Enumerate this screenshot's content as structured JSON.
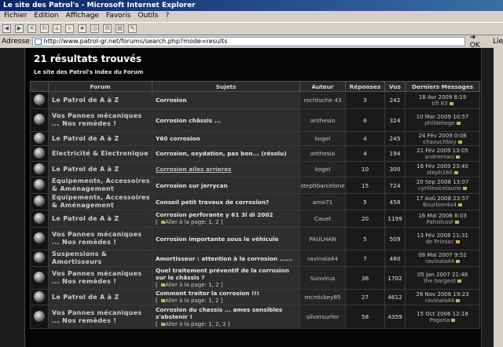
{
  "window": {
    "title": "Le site des Patrol's - Microsoft Internet Explorer"
  },
  "menu": [
    "Fichier",
    "Edition",
    "Affichage",
    "Favoris",
    "Outils",
    "?"
  ],
  "address": {
    "label": "Adresse",
    "url": "http://www.patrol-gr.net/forums/search.php?mode=results",
    "go": "OK",
    "links": "Lie"
  },
  "page": {
    "heading": "21 résultats trouvés",
    "index": "Le site des Patrol's Index du Forum"
  },
  "columns": [
    "Forum",
    "Sujets",
    "Auteur",
    "Réponses",
    "Vus",
    "Derniers Messages"
  ],
  "pager_prefix": "[ ",
  "rows": [
    {
      "forum": "Le Patrol de A à Z",
      "topic": "Corrosion",
      "pages": "",
      "author": "rochtoche 43",
      "replies": "3",
      "views": "242",
      "date": "18 Avr 2009 8:19",
      "user": "tifi 83"
    },
    {
      "forum": "Vos Pannes mécaniques ... Nos remèdes !",
      "topic": "Corrosion châssis ...",
      "pages": "",
      "author": "anthesio",
      "replies": "6",
      "views": "324",
      "date": "10 Mar 2009 10:57",
      "user": "phildeliege"
    },
    {
      "forum": "Le Patrol de A à Z",
      "topic": "Y60 corrosion",
      "pages": "",
      "author": "kogel",
      "replies": "4",
      "views": "245",
      "date": "24 Fév 2009 0:08",
      "user": "chaouchboy"
    },
    {
      "forum": "Electricité & Electronique",
      "topic": "Corrosion, oxydation, pas bon... (résolu)",
      "pages": "",
      "author": "anthesio",
      "replies": "4",
      "views": "194",
      "date": "21 Fév 2009 13:05",
      "user": "andremarc"
    },
    {
      "forum": "Le Patrol de A à Z",
      "topic": "Corrosion ailes arrieres",
      "pages": "",
      "author": "kogel",
      "replies": "10",
      "views": "300",
      "date": "16 Fév 2009 23:40",
      "user": "steph160",
      "link": true
    },
    {
      "forum": "Equipements, Accessoires & Aménagement",
      "topic": "Corrosion sur jerrycan",
      "pages": "",
      "author": "stephbarcelone",
      "replies": "15",
      "views": "724",
      "date": "20 Sep 2008 13:07",
      "user": "cyrilleaicelaurie"
    },
    {
      "forum": "Equipements, Accessoires & Aménagement",
      "topic": "Conseil petit travaux de corrosion?",
      "pages": "",
      "author": "arno71",
      "replies": "5",
      "views": "458",
      "date": "17 Aoû 2008 23:57",
      "user": "Bourbier4x4"
    },
    {
      "forum": "Le Patrol de A à Z",
      "topic": "Corrosion perforante y 61 3l di 2002",
      "pages": "Aller à la page: 1, 2 ]",
      "author": "Cauet",
      "replies": "20",
      "views": "1199",
      "date": "16 Mai 2008 8:03",
      "user": "Patrolcool"
    },
    {
      "forum": "Vos Pannes mécaniques ... Nos remèdes !",
      "topic": "Corrosion importante sous le véhicule",
      "pages": "",
      "author": "PAULHAN",
      "replies": "5",
      "views": "509",
      "date": "13 Fév 2008 11:31",
      "user": "de Prinsac"
    },
    {
      "forum": "Suspensions & Amortisseurs",
      "topic": "Amortisseur : attention à la corrosion ......",
      "pages": "",
      "author": "ravinala44",
      "replies": "7",
      "views": "480",
      "date": "08 Mai 2007 9:52",
      "user": "ravinala44"
    },
    {
      "forum": "Vos Pannes mécaniques ... Nos remèdes !",
      "topic": "Quel traitement préventif de la corrosion sur le châssis ?",
      "pages": "Aller à la page: 1, 2 ]",
      "author": "Sunvirus",
      "replies": "36",
      "views": "1702",
      "date": "05 Jan 2007 21:48",
      "user": "the bargeot"
    },
    {
      "forum": "Le Patrol de A à Z",
      "topic": "Comment traiter la corrosion !!!",
      "pages": "Aller à la page: 1, 2 ]",
      "author": "mcmickey85",
      "replies": "27",
      "views": "4612",
      "date": "26 Nov 2006 19:23",
      "user": "ravinala44"
    },
    {
      "forum": "Vos Pannes mécaniques ... Nos remèdes !",
      "topic": "Corrosion du chassis ... ames sensibles s'abstenir !",
      "pages": "Aller à la page: 1, 2, 3 ]",
      "author": "silversurfer",
      "replies": "58",
      "views": "4359",
      "date": "15 Oct 2006 12:18",
      "user": "Pogona"
    }
  ]
}
